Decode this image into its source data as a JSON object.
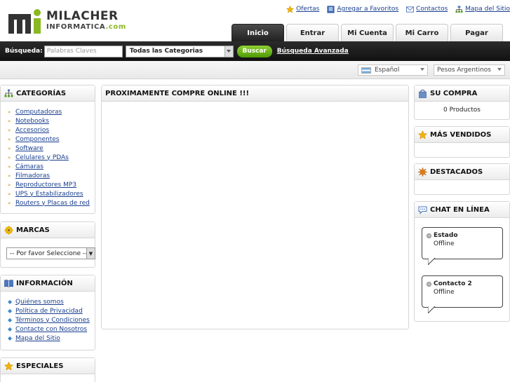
{
  "logo": {
    "name1": "MILACHER",
    "name2": "INFORMATICA",
    "name2_suffix": ".com"
  },
  "toplinks": [
    {
      "label": "Ofertas",
      "icon": "star-icon"
    },
    {
      "label": "Agregar a Favoritos",
      "icon": "bookmark-icon"
    },
    {
      "label": "Contactos",
      "icon": "envelope-icon"
    },
    {
      "label": "Mapa del Sitio",
      "icon": "sitemap-icon"
    }
  ],
  "tabs": [
    "Inicio",
    "Entrar",
    "Mi Cuenta",
    "Mi Carro",
    "Pagar"
  ],
  "search": {
    "label": "Búsqueda:",
    "placeholder": "Palabras Claves",
    "category": "Todas las Categorias",
    "button": "Buscar",
    "advanced": "Búsqueda Avanzada"
  },
  "language": "Español",
  "currency": "Pesos Argentinos",
  "categories": {
    "title": "CATEGORÍAS",
    "items": [
      "Computadoras",
      "Notebooks",
      "Accesorios",
      "Componentes",
      "Software",
      "Celulares y PDAs",
      "Cámaras",
      "Filmadoras",
      "Reproductores MP3",
      "UPS y Estabilizadores",
      "Routers y Placas de red"
    ]
  },
  "marcas": {
    "title": "MARCAS",
    "select": "-- Por favor Seleccione --"
  },
  "informacion": {
    "title": "INFORMACIÓN",
    "items": [
      "Quiénes somos",
      "Política de Privacidad",
      "Términos y Condiciones",
      "Contacte con Nosotros",
      "Mapa del Sitio"
    ]
  },
  "especiales": {
    "title": "ESPECIALES"
  },
  "main": {
    "title": "PROXIMAMENTE COMPRE ONLINE !!!"
  },
  "compra": {
    "title": "SU COMPRA",
    "content": "0 Productos"
  },
  "vendidos": {
    "title": "MÁS VENDIDOS"
  },
  "destacados": {
    "title": "DESTACADOS"
  },
  "chat": {
    "title": "CHAT EN LÍNEA",
    "contacts": [
      {
        "name": "Estado",
        "status": "Offline"
      },
      {
        "name": "Contacto 2",
        "status": "Offline"
      }
    ]
  },
  "colors": {
    "accent_green": "#8ab820",
    "dark_bar": "#1a1a1a",
    "link": "#1a3f8f"
  }
}
